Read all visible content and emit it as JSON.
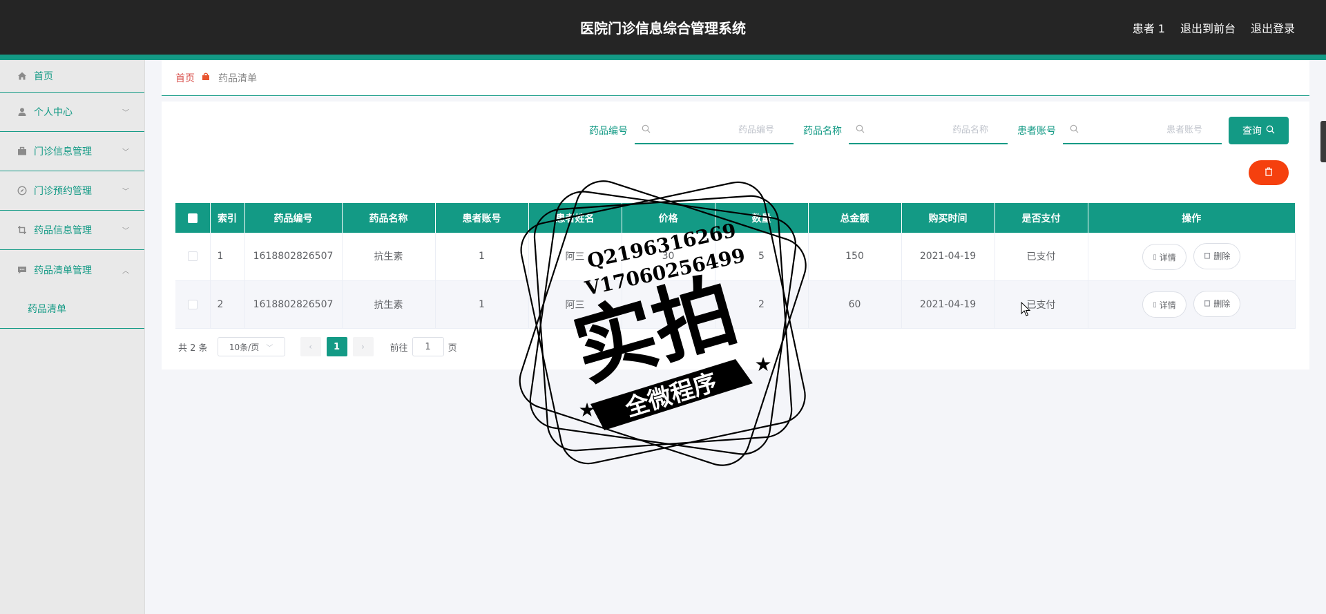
{
  "header": {
    "title": "医院门诊信息综合管理系统",
    "user": "患者 1",
    "back_to_front": "退出到前台",
    "logout": "退出登录"
  },
  "sidebar": {
    "items": [
      {
        "label": "首页",
        "icon": "home-icon"
      },
      {
        "label": "个人中心",
        "icon": "user-icon"
      },
      {
        "label": "门诊信息管理",
        "icon": "briefcase-icon"
      },
      {
        "label": "门诊预约管理",
        "icon": "compass-icon"
      },
      {
        "label": "药品信息管理",
        "icon": "crop-icon"
      },
      {
        "label": "药品清单管理",
        "icon": "chat-icon"
      }
    ],
    "subitem": "药品清单"
  },
  "breadcrumb": {
    "home": "首页",
    "current": "药品清单"
  },
  "search": {
    "drug_code_label": "药品编号",
    "drug_code_placeholder": "药品编号",
    "drug_name_label": "药品名称",
    "drug_name_placeholder": "药品名称",
    "patient_account_label": "患者账号",
    "patient_account_placeholder": "患者账号",
    "query_label": "查询"
  },
  "table": {
    "headers": [
      "索引",
      "药品编号",
      "药品名称",
      "患者账号",
      "患者姓名",
      "价格",
      "数量",
      "总金额",
      "购买时间",
      "是否支付",
      "操作"
    ],
    "rows": [
      {
        "index": "1",
        "code": "1618802826507",
        "name": "抗生素",
        "account": "1",
        "patient": "阿三",
        "price": "30",
        "qty": "5",
        "total": "150",
        "time": "2021-04-19",
        "paid": "已支付"
      },
      {
        "index": "2",
        "code": "1618802826507",
        "name": "抗生素",
        "account": "1",
        "patient": "阿三",
        "price": "30",
        "qty": "2",
        "total": "60",
        "time": "2021-04-19",
        "paid": "已支付"
      }
    ],
    "detail_label": "详情",
    "delete_label": "删除"
  },
  "pagination": {
    "total": "共 2 条",
    "page_size": "10条/页",
    "current_page": "1",
    "goto_prefix": "前往",
    "goto_value": "1",
    "goto_suffix": "页"
  },
  "watermark": {
    "line1": "Q2196316269",
    "line2": "V17060256499",
    "main": "实拍",
    "banner": "全微程序"
  },
  "colors": {
    "accent": "#139a85",
    "header_bg": "#252525",
    "danger": "#f5400e"
  }
}
